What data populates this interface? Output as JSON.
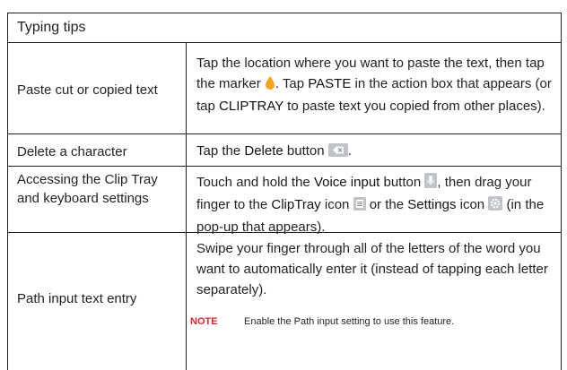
{
  "title": "Typing tips",
  "rows": [
    {
      "left": "Paste cut or copied text",
      "right_parts": [
        "Tap the location where you want to paste the text, then tap the marker ",
        ". Tap ",
        "PASTE",
        " in the action box that appears (or tap ",
        "CLIPTRAY",
        " to paste text you copied from other places)."
      ]
    },
    {
      "left": "Delete a character",
      "right_parts": [
        "Tap the ",
        "Delete",
        " button ",
        "."
      ]
    },
    {
      "left": "Accessing the Clip Tray and keyboard settings",
      "right_parts": [
        "Touch and hold the ",
        "Voice input",
        " button ",
        ", then drag your finger to the ",
        "ClipTray",
        " icon ",
        " or the ",
        "Settings",
        " icon ",
        " (in the pop-up that appears)."
      ]
    },
    {
      "left": "Path input text entry",
      "right": "Swipe your finger through all of the letters of the word you want to automatically enter it (instead of tapping each letter separately).",
      "note_label": "NOTE",
      "note_parts": [
        "Enable the ",
        "Path input",
        " setting to use this feature."
      ]
    }
  ],
  "icons": {
    "marker": "marker-icon",
    "delete": "delete-icon",
    "voice": "voice-input-icon",
    "cliptray": "cliptray-icon",
    "settings": "settings-icon"
  }
}
